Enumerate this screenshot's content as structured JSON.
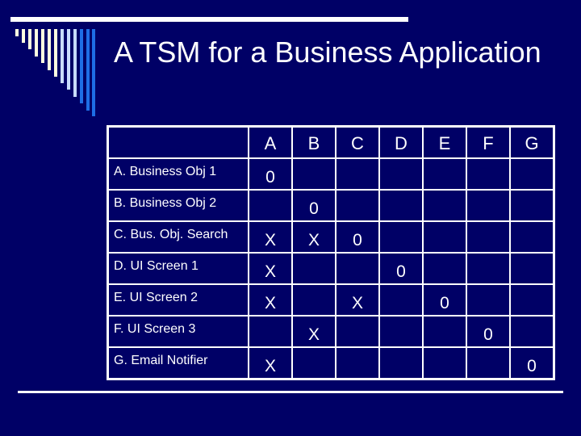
{
  "slide": {
    "title": "A TSM for a Business Application",
    "colors": {
      "background": "#000066",
      "text": "#ffffff",
      "rule": "#ffffff",
      "deco_cream": "#ffffe0",
      "deco_light_blue": "#c8dcff",
      "deco_blue": "#1e6ee6"
    }
  },
  "table": {
    "columns": [
      "A",
      "B",
      "C",
      "D",
      "E",
      "F",
      "G"
    ],
    "rows": [
      {
        "label": "A. Business Obj 1",
        "cells": [
          "0",
          "",
          "",
          "",
          "",
          "",
          ""
        ]
      },
      {
        "label": "B. Business Obj 2",
        "cells": [
          "",
          "0",
          "",
          "",
          "",
          "",
          ""
        ]
      },
      {
        "label": "C. Bus. Obj. Search",
        "cells": [
          "X",
          "X",
          "0",
          "",
          "",
          "",
          ""
        ]
      },
      {
        "label": "D. UI Screen 1",
        "cells": [
          "X",
          "",
          "",
          "0",
          "",
          "",
          ""
        ]
      },
      {
        "label": "E. UI Screen 2",
        "cells": [
          "X",
          "",
          "X",
          "",
          "0",
          "",
          ""
        ]
      },
      {
        "label": "F. UI Screen 3",
        "cells": [
          "",
          "X",
          "",
          "",
          "",
          "0",
          ""
        ]
      },
      {
        "label": "G. Email Notifier",
        "cells": [
          "X",
          "",
          "",
          "",
          "",
          "",
          "0"
        ]
      }
    ]
  }
}
